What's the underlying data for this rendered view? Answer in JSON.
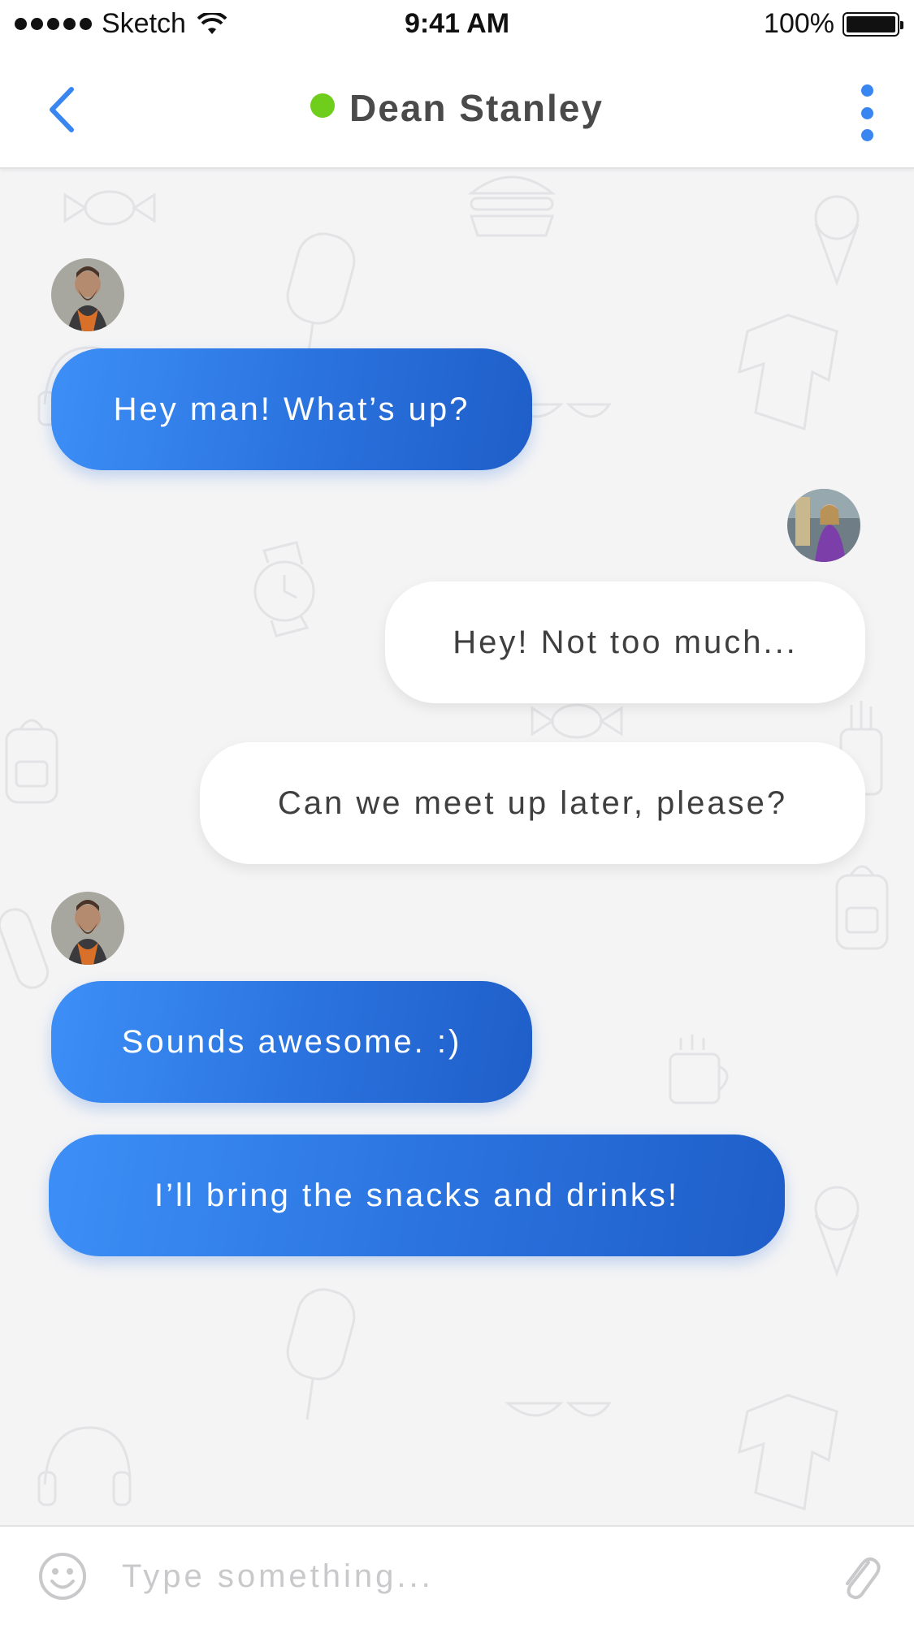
{
  "status_bar": {
    "carrier": "Sketch",
    "time": "9:41 AM",
    "battery": "100%"
  },
  "header": {
    "contact_name": "Dean Stanley",
    "online_color": "#6fcd1c",
    "accent_color": "#3a86f0"
  },
  "messages": [
    {
      "direction": "incoming",
      "text": "Hey man! What’s up?"
    },
    {
      "direction": "outgoing",
      "text": "Hey! Not too much..."
    },
    {
      "direction": "outgoing",
      "text": "Can we meet up later, please?"
    },
    {
      "direction": "incoming",
      "text": "Sounds awesome. :)"
    },
    {
      "direction": "incoming",
      "text": "I’ll bring the snacks and drinks!"
    }
  ],
  "composer": {
    "placeholder": "Type something...",
    "value": ""
  },
  "icons": {
    "back": "chevron-left-icon",
    "more": "more-vertical-icon",
    "emoji": "smiley-icon",
    "attach": "paperclip-icon"
  }
}
